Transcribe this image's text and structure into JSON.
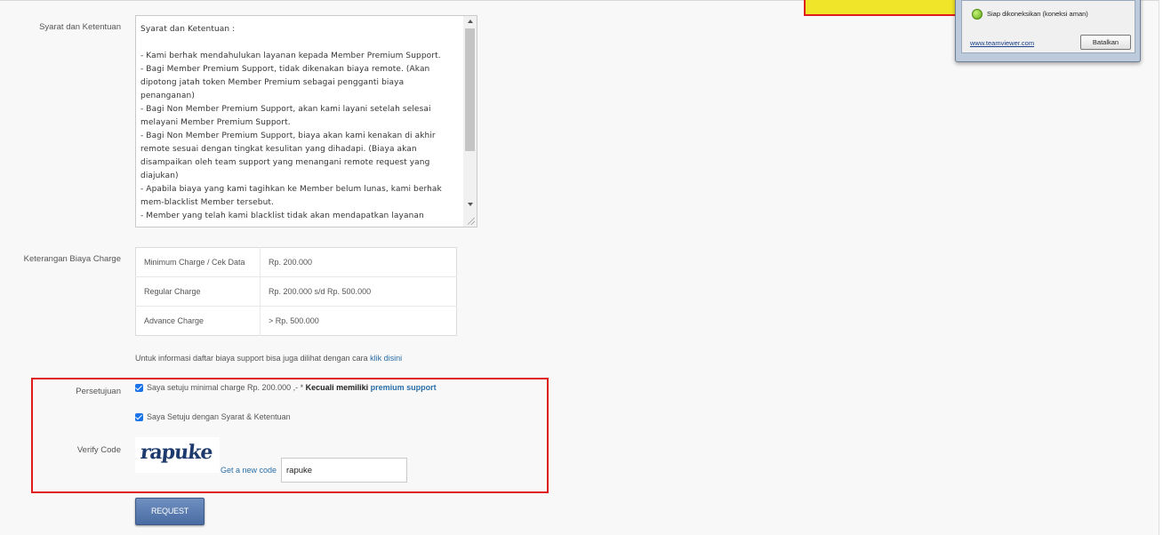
{
  "form": {
    "terms_label": "Syarat dan Ketentuan",
    "terms_text": "Syarat dan Ketentuan :\n\n- Kami berhak mendahulukan layanan kepada Member Premium Support.\n- Bagi Member Premium Support, tidak dikenakan biaya remote. (Akan dipotong jatah token Member Premium sebagai pengganti biaya penanganan)\n- Bagi Non Member Premium Support, akan kami layani setelah selesai melayani Member Premium Support.\n- Bagi Non Member Premium Support, biaya akan kami kenakan di akhir remote sesuai dengan tingkat kesulitan yang dihadapi. (Biaya akan disampaikan oleh team support yang menangani remote request yang diajukan)\n- Apabila biaya yang kami tagihkan ke Member belum lunas, kami berhak mem-blacklist Member tersebut.\n- Member yang telah kami blacklist tidak akan mendapatkan layanan",
    "charge_label": "Keterangan Biaya Charge",
    "charges": [
      {
        "name": "Minimum Charge / Cek Data",
        "value": "Rp. 200.000"
      },
      {
        "name": "Regular Charge",
        "value": "Rp. 200.000 s/d Rp. 500.000"
      },
      {
        "name": "Advance Charge",
        "value": "> Rp. 500.000"
      }
    ],
    "info_text": "Untuk informasi daftar biaya support bisa juga dilihat dengan cara ",
    "info_link": "klik disini",
    "agreement_label": "Persetujuan",
    "agree1_text": "Saya setuju minimal charge Rp. 200.000 ,- * ",
    "agree1_bold": "Kecuali memiliki ",
    "agree1_link": "premium support",
    "agree2_text": "Saya Setuju dengan Syarat & Ketentuan",
    "verify_label": "Verify Code",
    "captcha_word": "rapuke",
    "new_code_link": "Get a new code",
    "code_value": "rapuke",
    "request_button": "REQUEST"
  },
  "teamviewer": {
    "status": "Siap dikoneksikan (koneksi aman)",
    "link": "www.teamviewer.com",
    "cancel_button": "Batalkan"
  },
  "colors": {
    "highlight_border": "#e01b1b",
    "checkbox": "#1a73e8",
    "link": "#2a6ea8",
    "button": "#4a6ca3"
  }
}
